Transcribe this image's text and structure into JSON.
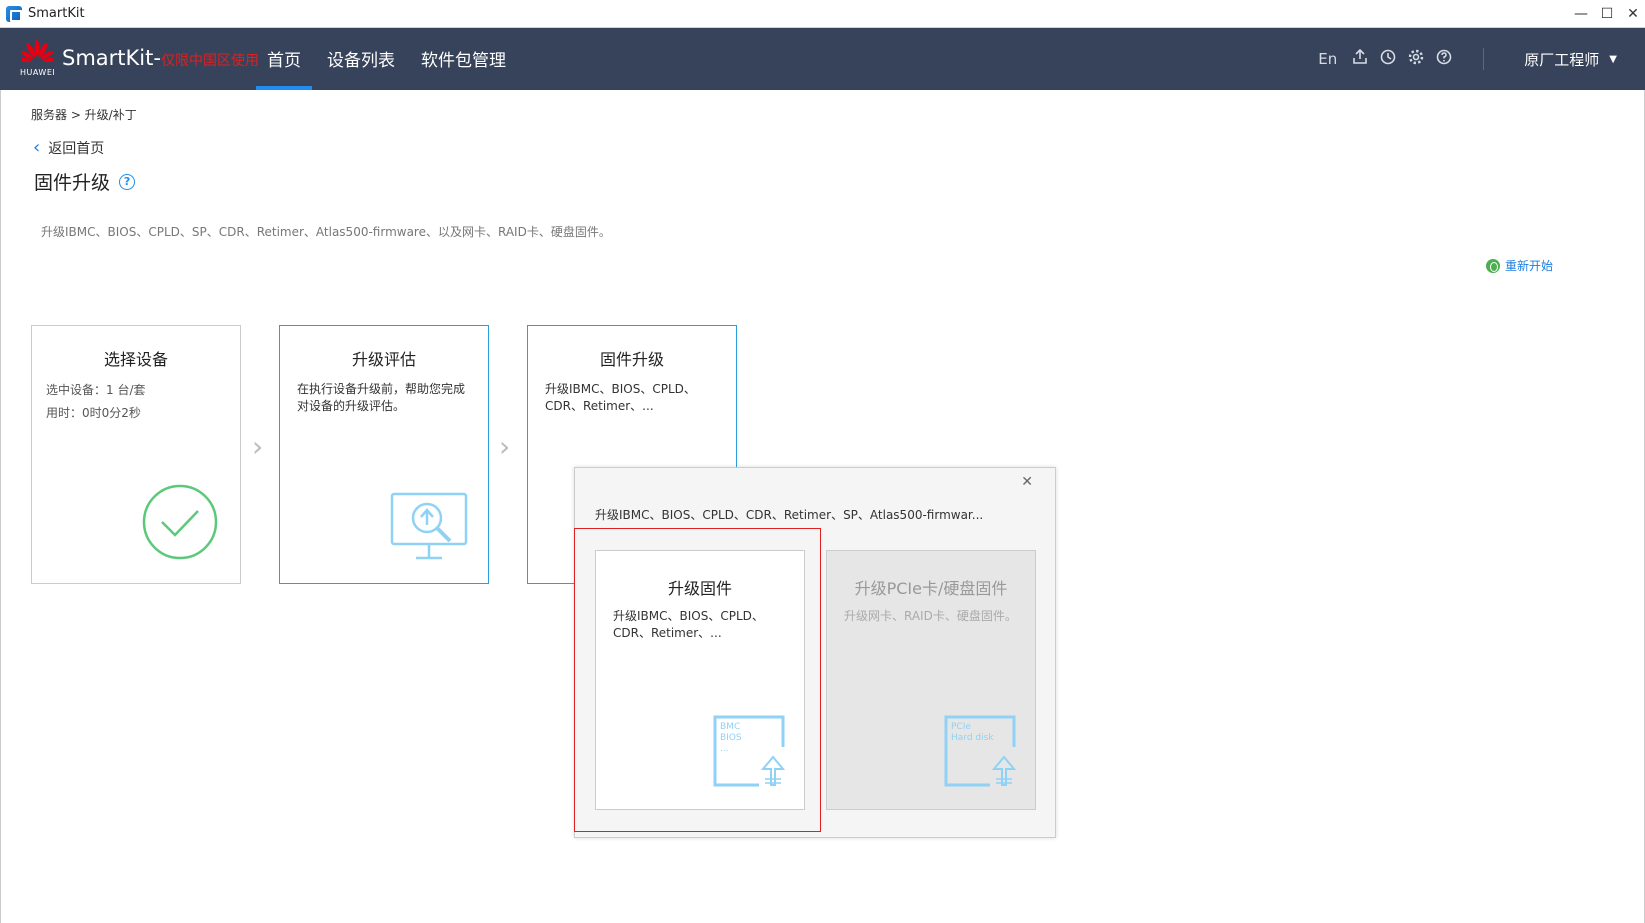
{
  "window": {
    "title": "SmartKit"
  },
  "navbar": {
    "brand": "HUAWEI",
    "app_name": "SmartKit-",
    "app_note": "仅限中国区使用",
    "tabs": [
      {
        "label": "首页"
      },
      {
        "label": "设备列表"
      },
      {
        "label": "软件包管理"
      }
    ],
    "lang": "En",
    "user": "原厂工程师"
  },
  "breadcrumb": "服务器 > 升级/补丁",
  "back": "返回首页",
  "page_title": "固件升级",
  "description": "升级IBMC、BIOS、CPLD、SP、CDR、Retimer、Atlas500-firmware、以及网卡、RAID卡、硬盘固件。",
  "restart": "重新开始",
  "steps": [
    {
      "title": "选择设备",
      "line1": "选中设备：1 台/套",
      "line2": "用时：0时0分2秒"
    },
    {
      "title": "升级评估",
      "text": "在执行设备升级前，帮助您完成对设备的升级评估。"
    },
    {
      "title": "固件升级",
      "text": "升级IBMC、BIOS、CPLD、CDR、Retimer、..."
    }
  ],
  "popup": {
    "description": "升级IBMC、BIOS、CPLD、CDR、Retimer、SP、Atlas500-firmwar...",
    "options": [
      {
        "title": "升级固件",
        "text": "升级IBMC、BIOS、CPLD、CDR、Retimer、...",
        "icon_lines": [
          "BMC",
          "BIOS",
          "..."
        ]
      },
      {
        "title": "升级PCIe卡/硬盘固件",
        "text": "升级网卡、RAID卡、硬盘固件。",
        "icon_lines": [
          "PCIe",
          "Hard disk"
        ]
      }
    ]
  },
  "colors": {
    "nav_bg": "#37435a",
    "accent": "#1f8df0",
    "success": "#5cc87a",
    "highlight": "#e02020"
  }
}
